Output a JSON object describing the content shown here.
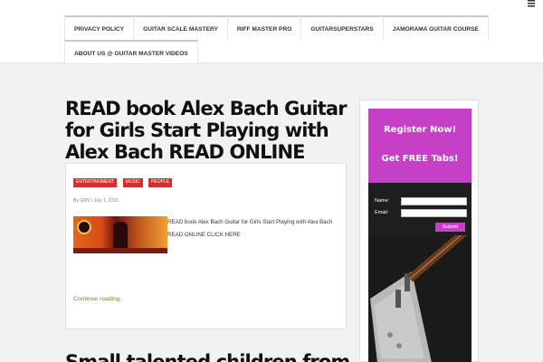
{
  "nav": {
    "row1": [
      "PRIVACY POLICY",
      "GUITAR SCALE MASTERY",
      "RIFF MASTER PRO",
      "GUITARSUPERSTARS",
      "JAMORAMA GUITAR COURSE"
    ],
    "row2": [
      "ABOUT US @ GUITAR MASTER VIDEOS"
    ]
  },
  "post": {
    "title": "READ book Alex Bach Guitar for Girls Start Playing with Alex Bach READ ONLINE",
    "tags": [
      "ENTERTAINMENT",
      "MUSIC",
      "PEOPLE"
    ],
    "meta": "By GMV / July 1, 2016",
    "excerpt": "READ book Alex Bach Guitar for Girls Start Playing with Alex Bach READ ONLINE CLICK HERE",
    "continue_label": "Continue reading"
  },
  "next_post": {
    "title": "Small talented children from"
  },
  "sidebar_ad": {
    "line1": "Register Now!",
    "line2": "Get FREE Tabs!",
    "name_label": "Name:",
    "email_label": "Email:",
    "submit_label": "Submit"
  },
  "colors": {
    "tag": "#d32f2f",
    "ad_accent": "#c63fc7",
    "link": "#6b8e23"
  }
}
